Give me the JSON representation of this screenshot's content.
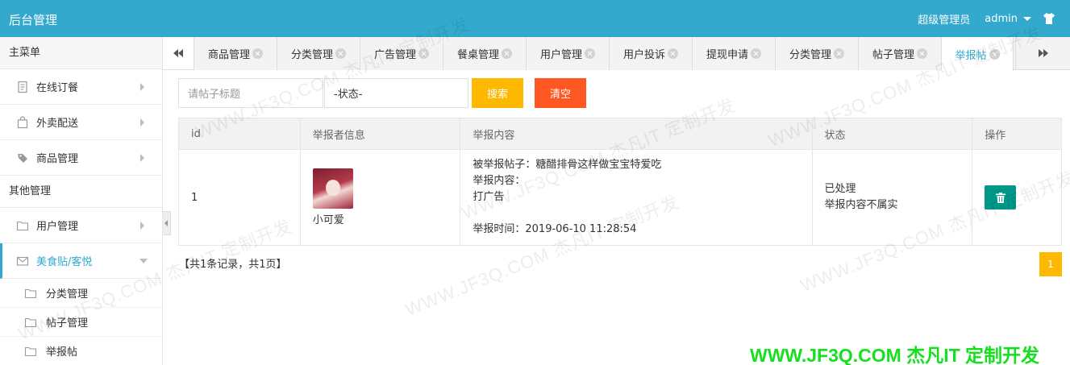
{
  "app": {
    "title": "后台管理",
    "role": "超级管理员",
    "user": "admin"
  },
  "sidebar": {
    "main_header": "主菜单",
    "main_items": [
      {
        "label": "在线订餐",
        "icon": "document-icon"
      },
      {
        "label": "外卖配送",
        "icon": "bag-icon"
      },
      {
        "label": "商品管理",
        "icon": "tag-icon"
      }
    ],
    "other_header": "其他管理",
    "other_items": [
      {
        "label": "用户管理",
        "icon": "folder-icon"
      },
      {
        "label": "美食贴/客悦",
        "icon": "mail-icon"
      }
    ],
    "sub_items": [
      {
        "label": "分类管理",
        "icon": "folder-icon"
      },
      {
        "label": "帖子管理",
        "icon": "folder-icon"
      },
      {
        "label": "举报帖",
        "icon": "folder-icon"
      }
    ]
  },
  "tabs": [
    "商品管理",
    "分类管理",
    "广告管理",
    "餐桌管理",
    "用户管理",
    "用户投诉",
    "提现申请",
    "分类管理",
    "帖子管理",
    "举报帖"
  ],
  "active_tab": "举报帖",
  "search": {
    "placeholder": "请帖子标题",
    "status": "-状态-",
    "search_label": "搜索",
    "clear_label": "清空"
  },
  "table": {
    "headers": [
      "id",
      "举报者信息",
      "举报内容",
      "状态",
      "操作"
    ],
    "rows": [
      {
        "id": "1",
        "reporter": "小可爱",
        "post_line": "被举报帖子：糖醋排骨这样做宝宝特爱吃",
        "content_label": "举报内容：",
        "content_text": "打广告",
        "time_line": "举报时间：2019-06-10 11:28:54",
        "status": "已处理",
        "status_note": "举报内容不属实"
      }
    ]
  },
  "footer": {
    "summary": "【共1条记录，共1页】",
    "page": "1"
  },
  "watermark": {
    "text": "WWW.JF3Q.COM 杰凡IT 定制开发",
    "brand": "WWW.JF3Q.COM 杰凡IT  定制开发"
  },
  "colors": {
    "primary": "#32a9cd",
    "search": "#ffb800",
    "clear": "#ff5722",
    "delete": "#009688",
    "brand": "#14e01e"
  }
}
